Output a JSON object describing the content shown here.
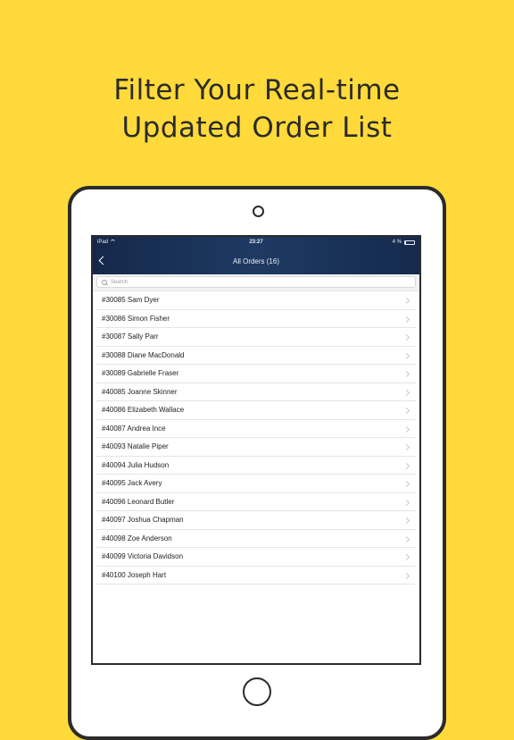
{
  "headline": {
    "line1": "Filter Your Real-time",
    "line2": "Updated Order List"
  },
  "status_bar": {
    "device": "iPad",
    "time": "23:27",
    "battery": "4 %"
  },
  "nav": {
    "title": "All Orders (16)"
  },
  "search": {
    "placeholder": "Search"
  },
  "orders": [
    "#30085 Sam Dyer",
    "#30086 Simon Fisher",
    "#30087 Sally Parr",
    "#30088 Diane MacDonald",
    "#30089 Gabrielle Fraser",
    "#40085 Joanne Skinner",
    "#40086 Elizabeth Wallace",
    "#40087 Andrea Ince",
    "#40093 Natalie Piper",
    "#40094 Julia Hudson",
    "#40095 Jack Avery",
    "#40096 Leonard Butler",
    "#40097 Joshua Chapman",
    "#40098 Zoe Anderson",
    "#40099 Victoria Davidson",
    "#40100 Joseph Hart"
  ]
}
